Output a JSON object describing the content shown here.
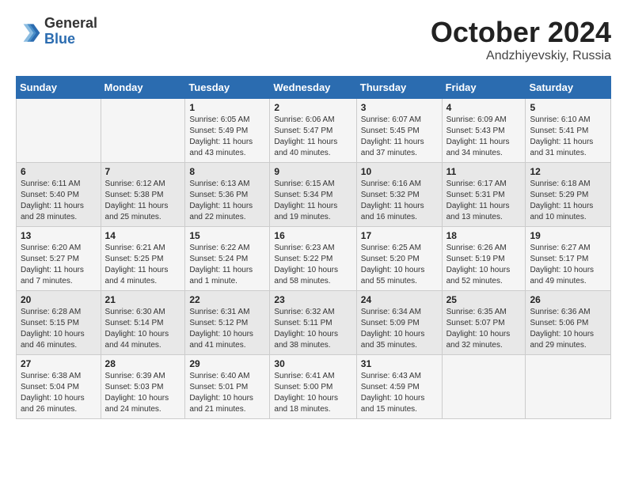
{
  "header": {
    "logo_general": "General",
    "logo_blue": "Blue",
    "month": "October 2024",
    "location": "Andzhiyevskiy, Russia"
  },
  "weekdays": [
    "Sunday",
    "Monday",
    "Tuesday",
    "Wednesday",
    "Thursday",
    "Friday",
    "Saturday"
  ],
  "weeks": [
    [
      {
        "day": "",
        "info": ""
      },
      {
        "day": "",
        "info": ""
      },
      {
        "day": "1",
        "info": "Sunrise: 6:05 AM\nSunset: 5:49 PM\nDaylight: 11 hours and 43 minutes."
      },
      {
        "day": "2",
        "info": "Sunrise: 6:06 AM\nSunset: 5:47 PM\nDaylight: 11 hours and 40 minutes."
      },
      {
        "day": "3",
        "info": "Sunrise: 6:07 AM\nSunset: 5:45 PM\nDaylight: 11 hours and 37 minutes."
      },
      {
        "day": "4",
        "info": "Sunrise: 6:09 AM\nSunset: 5:43 PM\nDaylight: 11 hours and 34 minutes."
      },
      {
        "day": "5",
        "info": "Sunrise: 6:10 AM\nSunset: 5:41 PM\nDaylight: 11 hours and 31 minutes."
      }
    ],
    [
      {
        "day": "6",
        "info": "Sunrise: 6:11 AM\nSunset: 5:40 PM\nDaylight: 11 hours and 28 minutes."
      },
      {
        "day": "7",
        "info": "Sunrise: 6:12 AM\nSunset: 5:38 PM\nDaylight: 11 hours and 25 minutes."
      },
      {
        "day": "8",
        "info": "Sunrise: 6:13 AM\nSunset: 5:36 PM\nDaylight: 11 hours and 22 minutes."
      },
      {
        "day": "9",
        "info": "Sunrise: 6:15 AM\nSunset: 5:34 PM\nDaylight: 11 hours and 19 minutes."
      },
      {
        "day": "10",
        "info": "Sunrise: 6:16 AM\nSunset: 5:32 PM\nDaylight: 11 hours and 16 minutes."
      },
      {
        "day": "11",
        "info": "Sunrise: 6:17 AM\nSunset: 5:31 PM\nDaylight: 11 hours and 13 minutes."
      },
      {
        "day": "12",
        "info": "Sunrise: 6:18 AM\nSunset: 5:29 PM\nDaylight: 11 hours and 10 minutes."
      }
    ],
    [
      {
        "day": "13",
        "info": "Sunrise: 6:20 AM\nSunset: 5:27 PM\nDaylight: 11 hours and 7 minutes."
      },
      {
        "day": "14",
        "info": "Sunrise: 6:21 AM\nSunset: 5:25 PM\nDaylight: 11 hours and 4 minutes."
      },
      {
        "day": "15",
        "info": "Sunrise: 6:22 AM\nSunset: 5:24 PM\nDaylight: 11 hours and 1 minute."
      },
      {
        "day": "16",
        "info": "Sunrise: 6:23 AM\nSunset: 5:22 PM\nDaylight: 10 hours and 58 minutes."
      },
      {
        "day": "17",
        "info": "Sunrise: 6:25 AM\nSunset: 5:20 PM\nDaylight: 10 hours and 55 minutes."
      },
      {
        "day": "18",
        "info": "Sunrise: 6:26 AM\nSunset: 5:19 PM\nDaylight: 10 hours and 52 minutes."
      },
      {
        "day": "19",
        "info": "Sunrise: 6:27 AM\nSunset: 5:17 PM\nDaylight: 10 hours and 49 minutes."
      }
    ],
    [
      {
        "day": "20",
        "info": "Sunrise: 6:28 AM\nSunset: 5:15 PM\nDaylight: 10 hours and 46 minutes."
      },
      {
        "day": "21",
        "info": "Sunrise: 6:30 AM\nSunset: 5:14 PM\nDaylight: 10 hours and 44 minutes."
      },
      {
        "day": "22",
        "info": "Sunrise: 6:31 AM\nSunset: 5:12 PM\nDaylight: 10 hours and 41 minutes."
      },
      {
        "day": "23",
        "info": "Sunrise: 6:32 AM\nSunset: 5:11 PM\nDaylight: 10 hours and 38 minutes."
      },
      {
        "day": "24",
        "info": "Sunrise: 6:34 AM\nSunset: 5:09 PM\nDaylight: 10 hours and 35 minutes."
      },
      {
        "day": "25",
        "info": "Sunrise: 6:35 AM\nSunset: 5:07 PM\nDaylight: 10 hours and 32 minutes."
      },
      {
        "day": "26",
        "info": "Sunrise: 6:36 AM\nSunset: 5:06 PM\nDaylight: 10 hours and 29 minutes."
      }
    ],
    [
      {
        "day": "27",
        "info": "Sunrise: 6:38 AM\nSunset: 5:04 PM\nDaylight: 10 hours and 26 minutes."
      },
      {
        "day": "28",
        "info": "Sunrise: 6:39 AM\nSunset: 5:03 PM\nDaylight: 10 hours and 24 minutes."
      },
      {
        "day": "29",
        "info": "Sunrise: 6:40 AM\nSunset: 5:01 PM\nDaylight: 10 hours and 21 minutes."
      },
      {
        "day": "30",
        "info": "Sunrise: 6:41 AM\nSunset: 5:00 PM\nDaylight: 10 hours and 18 minutes."
      },
      {
        "day": "31",
        "info": "Sunrise: 6:43 AM\nSunset: 4:59 PM\nDaylight: 10 hours and 15 minutes."
      },
      {
        "day": "",
        "info": ""
      },
      {
        "day": "",
        "info": ""
      }
    ]
  ]
}
